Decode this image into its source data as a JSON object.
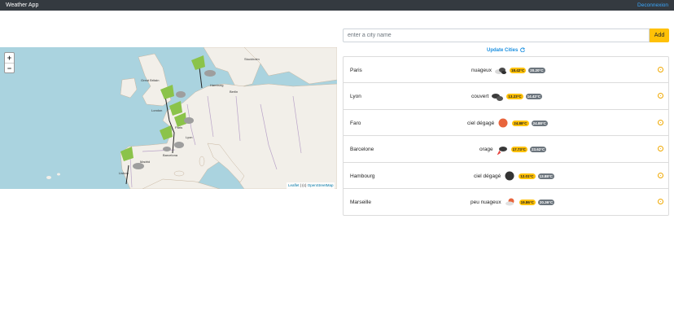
{
  "navbar": {
    "brand": "Weather App",
    "logout": "Deconnexion"
  },
  "map": {
    "zoom_in": "+",
    "zoom_out": "−",
    "attribution": {
      "leaflet": "Leaflet",
      "sep": " | (c) ",
      "osm": "OpenStreetMap"
    },
    "labels": [
      "Great Britain",
      "London",
      "Hamburg",
      "Berlin",
      "Paris",
      "Lyon",
      "Barcelona",
      "Madrid",
      "Lisbon",
      "Stockholm"
    ]
  },
  "search": {
    "placeholder": "enter a city name",
    "add_label": "Add"
  },
  "update_label": "Update Cities",
  "cities": [
    {
      "name": "Paris",
      "description": "nuageux",
      "icon": "broken-clouds-icon",
      "min": "18.42°C",
      "max": "20.20°C"
    },
    {
      "name": "Lyon",
      "description": "couvert",
      "icon": "overcast-icon",
      "min": "13.23°C",
      "max": "14.42°C"
    },
    {
      "name": "Faro",
      "description": "ciel dégagé",
      "icon": "clear-sky-day-icon",
      "min": "24.88°C",
      "max": "24.88°C"
    },
    {
      "name": "Barcelone",
      "description": "orage",
      "icon": "thunderstorm-icon",
      "min": "17.73°C",
      "max": "23.62°C"
    },
    {
      "name": "Hambourg",
      "description": "ciel dégagé",
      "icon": "clear-sky-night-icon",
      "min": "12.01°C",
      "max": "13.88°C"
    },
    {
      "name": "Marseille",
      "description": "peu nuageux",
      "icon": "few-clouds-icon",
      "min": "19.86°C",
      "max": "20.36°C"
    }
  ],
  "colors": {
    "navbar": "#343a40",
    "accent": "#ffc107",
    "link": "#1a8fe0",
    "sea": "#aad3df",
    "land": "#f2efe9"
  }
}
